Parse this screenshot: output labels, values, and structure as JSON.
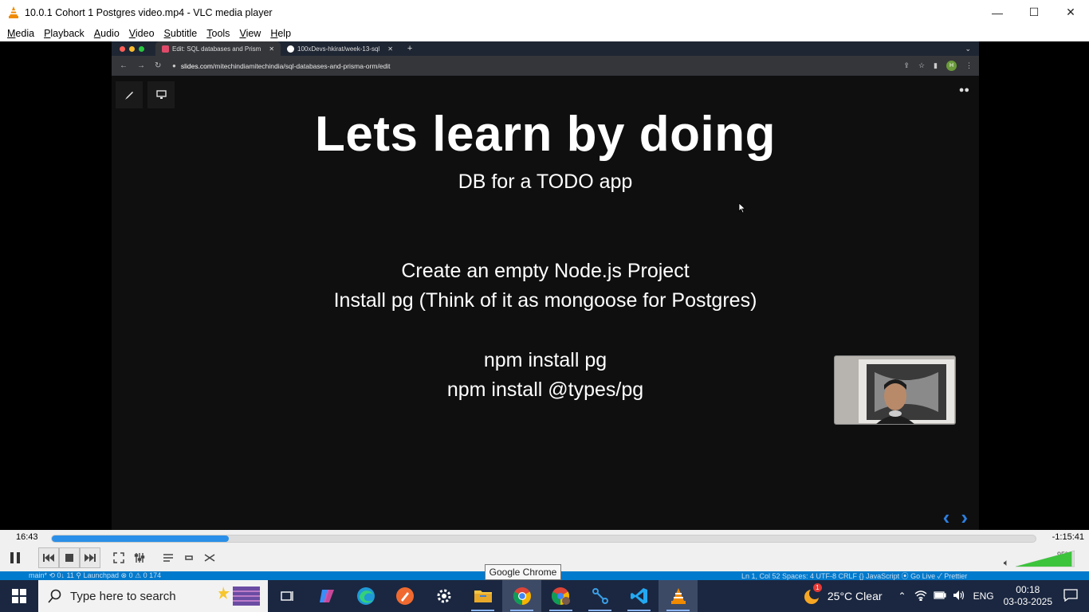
{
  "window": {
    "title": "10.0.1  Cohort 1 Postgres video.mp4 - VLC media player",
    "minimize": "—",
    "maximize": "☐",
    "close": "✕"
  },
  "menu": [
    "Media",
    "Playback",
    "Audio",
    "Video",
    "Subtitle",
    "Tools",
    "View",
    "Help"
  ],
  "browser": {
    "tabs": [
      {
        "label": "Edit: SQL databases and Prism",
        "close": "✕",
        "favicon_color": "#e04a6a"
      },
      {
        "label": "100xDevs-hkirat/week-13-sql",
        "close": "✕",
        "favicon_color": "#ffffff"
      }
    ],
    "new_tab": "+",
    "url_host": "slides.com",
    "url_path": "/mitechindiamitechindia/sql-databases-and-prisma-orm/edit",
    "avatar": "H"
  },
  "slide": {
    "title": "Lets learn by doing",
    "subtitle": "DB for a TODO app",
    "lines": [
      "Create an empty Node.js Project",
      "Install pg (Think of it as mongoose for Postgres)",
      "npm install pg",
      "npm install @types/pg"
    ],
    "prev": "‹",
    "next": "›"
  },
  "player": {
    "elapsed": "16:43",
    "remaining": "-1:15:41",
    "progress_fraction": 0.18,
    "volume": "95%",
    "volume_fraction": 0.95
  },
  "vscode_status": {
    "left": "main*  ⟲ 0↓ 11   ⚲ Launchpad   ⊗ 0 ⚠ 0   174",
    "right": "Ln 1, Col 52   Spaces: 4   UTF-8   CRLF   {} JavaScript   ⦿ Go Live   ✓ Prettier"
  },
  "taskbar": {
    "search_placeholder": "Type here to search",
    "tooltip": "Google Chrome",
    "weather": "25°C  Clear",
    "weather_badge": "1",
    "language": "ENG",
    "time": "00:18",
    "date": "03-03-2025"
  }
}
